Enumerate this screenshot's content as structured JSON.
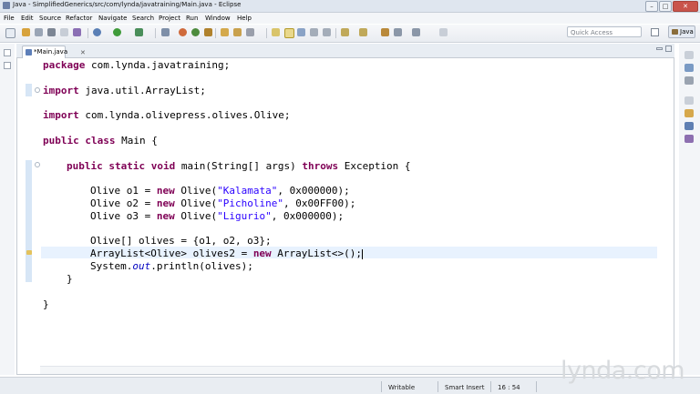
{
  "window": {
    "title": "Java - SimplifiedGenerics/src/com/lynda/javatraining/Main.java - Eclipse",
    "minimize": "–",
    "maximize": "□",
    "close": "✕"
  },
  "menu": [
    "File",
    "Edit",
    "Source",
    "Refactor",
    "Navigate",
    "Search",
    "Project",
    "Run",
    "Window",
    "Help"
  ],
  "toolbar": {
    "quick_access_placeholder": "Quick Access",
    "perspective_label": "Java"
  },
  "editor": {
    "tab_label": "*Main.java",
    "tab_close": "✕",
    "code_lines": [
      "package com.lynda.javatraining;",
      "import java.util.ArrayList;",
      "import com.lynda.olivepress.olives.Olive;",
      "public class Main {",
      "public static void main(String[] args) throws Exception {",
      "Olive o1 = new Olive(\"Kalamata\", 0x000000);",
      "Olive o2 = new Olive(\"Picholine\", 0x00FF00);",
      "Olive o3 = new Olive(\"Ligurio\", 0x000000);",
      "Olive[] olives = {o1, o2, o3};",
      "ArrayList<Olive> olives2 = new ArrayList<>();",
      "System.out.println(olives);",
      "}",
      "}"
    ]
  },
  "status": {
    "mode": "Writable",
    "insert": "Smart Insert",
    "position": "16 : 54"
  },
  "watermark": "lynda.com",
  "icons": {
    "app": "eclipse-java-icon",
    "tab": "java-file-icon",
    "perspective": "java-perspective-icon"
  },
  "colors": {
    "keyword": "#7f0055",
    "string": "#2a00ff",
    "static_field": "#0000c0",
    "current_line": "#e8f2fe"
  }
}
